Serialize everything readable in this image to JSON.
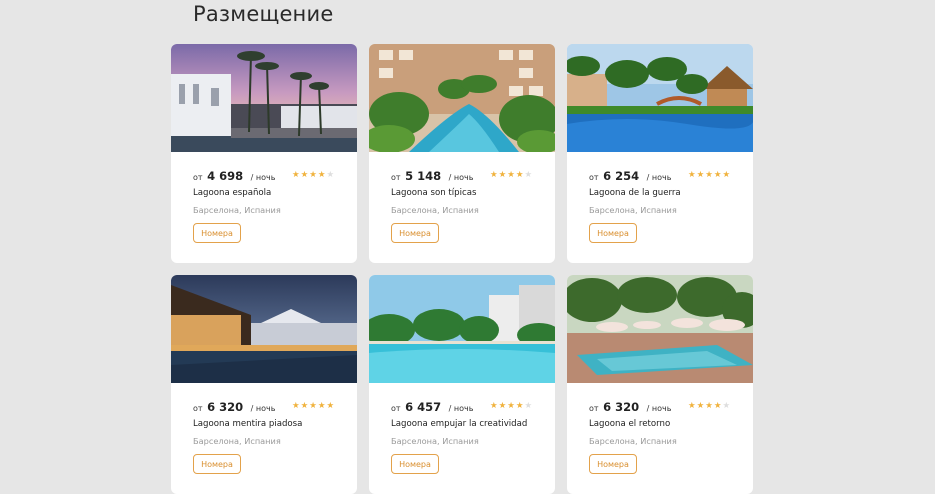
{
  "page_title": "Размещение",
  "labels": {
    "from": "от",
    "per_night": "/ ночь",
    "rooms": "Номера"
  },
  "colors": {
    "star_active": "#f0b23d",
    "star_inactive": "#dedede",
    "button_accent": "#e3a24b"
  },
  "hotels": [
    {
      "name": "Lagoona española",
      "price": "4 698",
      "location": "Барселона, Испания",
      "stars": 4
    },
    {
      "name": "Lagoona son típicas",
      "price": "5 148",
      "location": "Барселона, Испания",
      "stars": 4
    },
    {
      "name": "Lagoona de la guerra",
      "price": "6 254",
      "location": "Барселона, Испания",
      "stars": 5
    },
    {
      "name": "Lagoona mentira piadosa",
      "price": "6 320",
      "location": "Барселона, Испания",
      "stars": 5
    },
    {
      "name": "Lagoona empujar la creatividad",
      "price": "6 457",
      "location": "Барселона, Испания",
      "stars": 4
    },
    {
      "name": "Lagoona el retorno",
      "price": "6 320",
      "location": "Барселона, Испания",
      "stars": 4
    }
  ]
}
